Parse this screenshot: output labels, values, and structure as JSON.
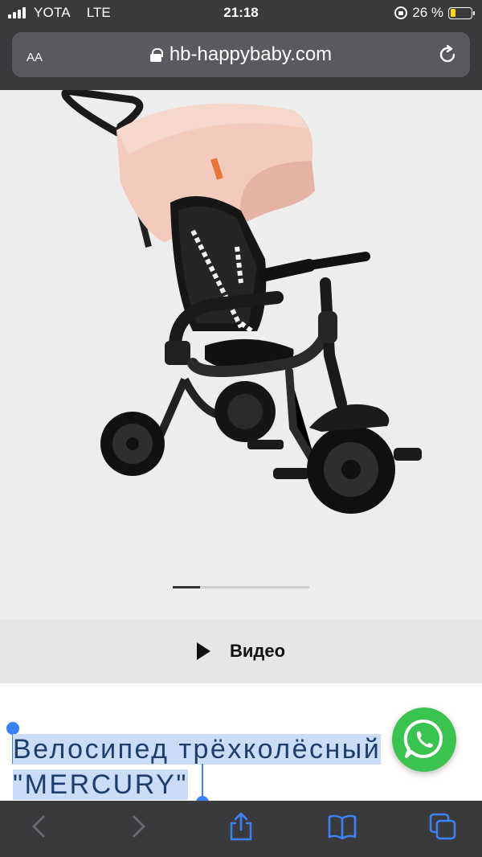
{
  "status_bar": {
    "carrier": "YOTA",
    "network": "LTE",
    "time": "21:18",
    "battery_percent": "26 %",
    "battery_level": 0.26,
    "battery_color": "#ffd60a"
  },
  "address_bar": {
    "text_size_label": "AA",
    "url": "hb-happybaby.com"
  },
  "gallery": {
    "image_subject": "tricycle-mercury",
    "page_count": 5,
    "current_page": 1
  },
  "video": {
    "label": "Видео"
  },
  "product": {
    "title_line1": "Велосипед трёхколёсный",
    "title_line2": "\"MERCURY\"",
    "title_color": "#1c3d6e",
    "selection_color": "#cbdcf6"
  },
  "icons": {
    "whatsapp": "whatsapp-icon",
    "back": "chevron-left-icon",
    "forward": "chevron-right-icon",
    "share": "share-icon",
    "bookmarks": "book-icon",
    "tabs": "tabs-icon"
  },
  "colors": {
    "browser_chrome": "#3a3a3c",
    "accent": "#3b82f6",
    "whatsapp_green": "#3bc34f"
  }
}
